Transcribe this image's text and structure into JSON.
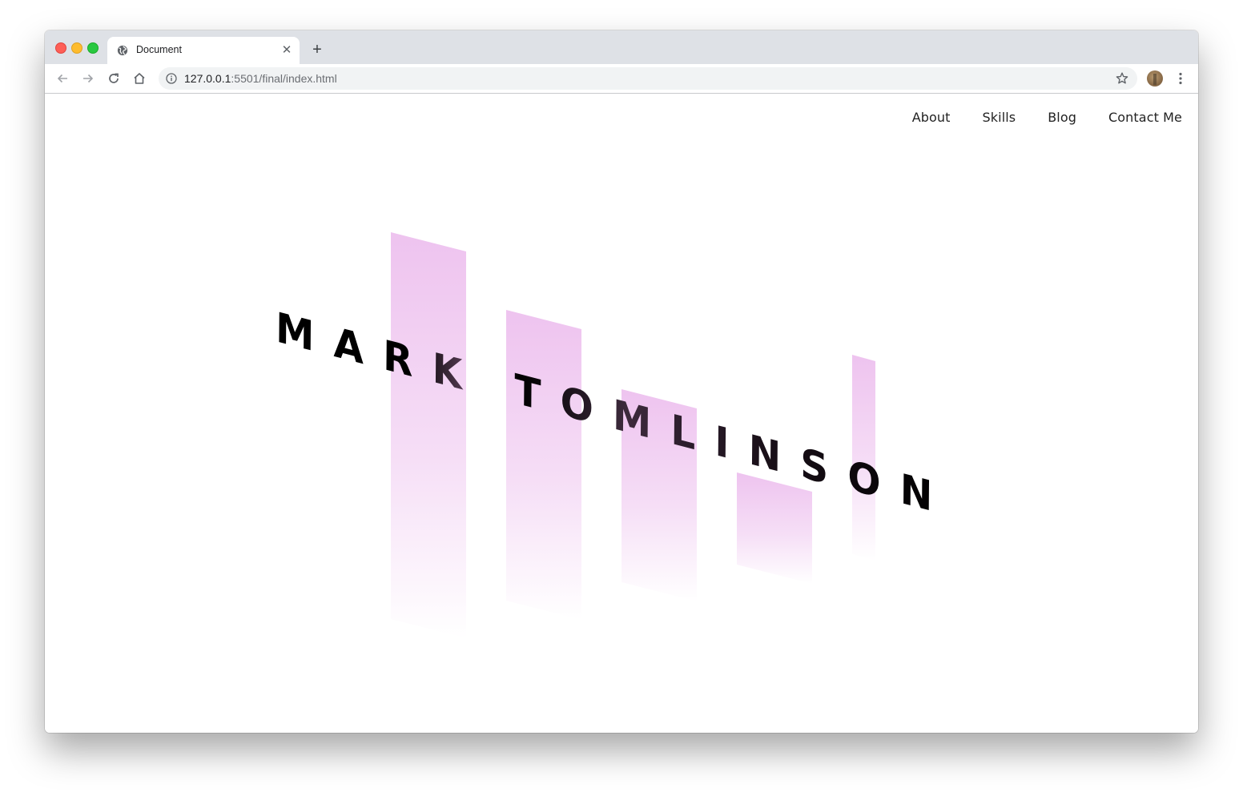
{
  "browser": {
    "tab_title": "Document",
    "url_host": "127.0.0.1",
    "url_rest": ":5501/final/index.html"
  },
  "nav": {
    "items": [
      {
        "label": "About"
      },
      {
        "label": "Skills"
      },
      {
        "label": "Blog"
      },
      {
        "label": "Contact Me"
      }
    ]
  },
  "hero": {
    "name": "MARK TOMLINSON",
    "bar_color": "#eec3ef"
  }
}
